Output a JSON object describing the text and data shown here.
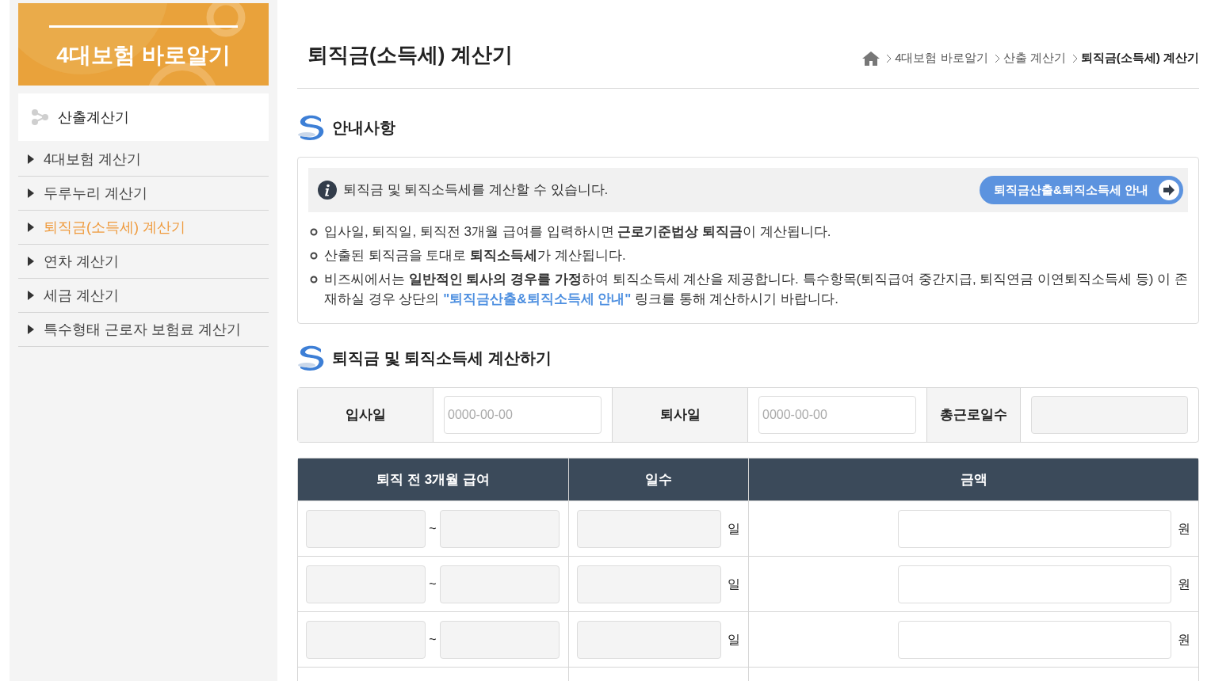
{
  "sidebar": {
    "banner_title": "4대보험 바로알기",
    "section": "산출계산기",
    "items": [
      {
        "label": "4대보험 계산기",
        "selected": false
      },
      {
        "label": "두루누리 계산기",
        "selected": false
      },
      {
        "label": "퇴직금(소득세) 계산기",
        "selected": true
      },
      {
        "label": "연차 계산기",
        "selected": false
      },
      {
        "label": "세금 계산기",
        "selected": false
      },
      {
        "label": "특수형태 근로자 보험료 계산기",
        "selected": false
      }
    ]
  },
  "page_title": "퇴직금(소득세) 계산기",
  "breadcrumb": [
    "4대보험 바로알기",
    "산출 계산기",
    "퇴직금(소득세) 계산기"
  ],
  "notice": {
    "heading": "안내사항",
    "info": "퇴직금 및 퇴직소득세를 계산할 수 있습니다.",
    "guide_button": "퇴직금산출&퇴직소득세 안내",
    "notes": [
      {
        "text": "입사일, 퇴직일, 퇴직전 3개월 급여를 입력하시면 **근로기준법상 퇴직금**이 계산됩니다."
      },
      {
        "text": "산출된 퇴직금을 토대로 **퇴직소득세**가 계산됩니다."
      },
      {
        "text": "비즈씨에서는 **일반적인 퇴사의 경우를 가정**하여 퇴직소득세 계산을 제공합니다. 특수항목(퇴직급여 중간지급, 퇴직연금 이연퇴직소득세 등) 이 존재하실 경우 상단의",
        "link": "\"퇴직금산출&퇴직소득세 안내\"",
        "text_after": "링크를 통해 계산하시기 바랍니다."
      }
    ]
  },
  "calc": {
    "heading": "퇴직금 및 퇴직소득세 계산하기",
    "dates": {
      "start_label": "입사일",
      "start_placeholder": "0000-00-00",
      "end_label": "퇴사일",
      "end_placeholder": "0000-00-00",
      "total_label": "총근로일수"
    },
    "columns": [
      "퇴직 전 3개월 급여",
      "일수",
      "금액"
    ],
    "rows": [
      {
        "sep": "~",
        "day_unit": "일",
        "won_unit": "원"
      },
      {
        "sep": "~",
        "day_unit": "일",
        "won_unit": "원"
      },
      {
        "sep": "~",
        "day_unit": "일",
        "won_unit": "원"
      }
    ]
  }
}
